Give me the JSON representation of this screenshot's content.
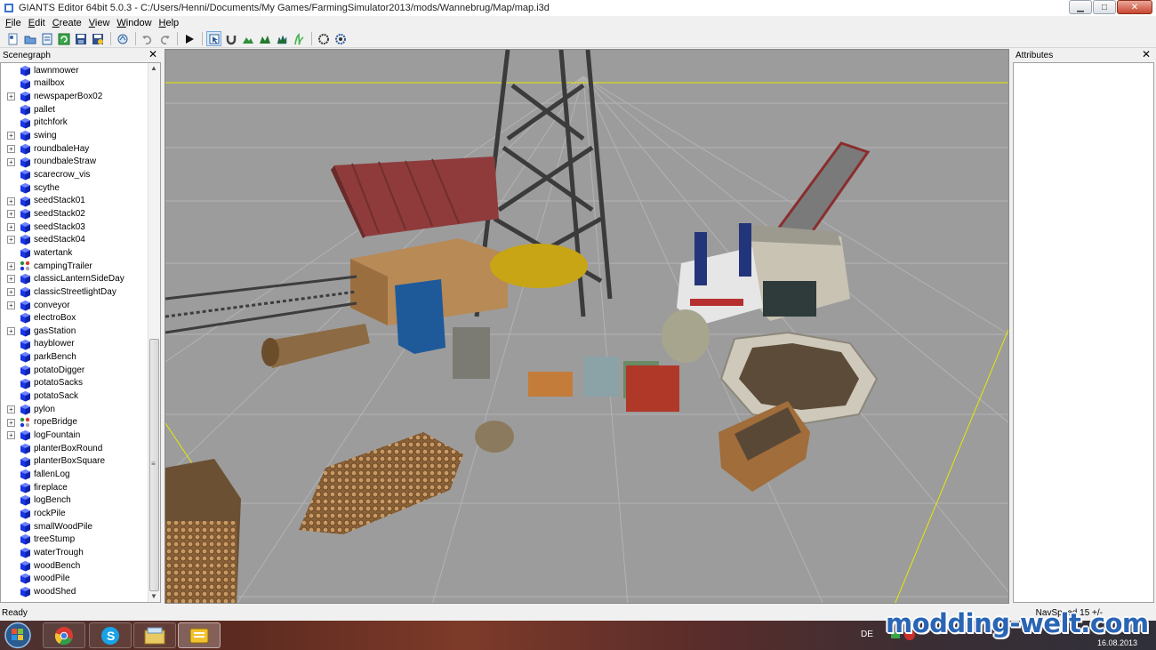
{
  "window": {
    "title": "GIANTS Editor 64bit 5.0.3 - C:/Users/Henni/Documents/My Games/FarmingSimulator2013/mods/Wannebrug/Map/map.i3d",
    "buttons": {
      "minimize": "▁",
      "maximize": "□",
      "close": "✕"
    }
  },
  "menu": {
    "items": [
      {
        "label": "File",
        "u": "F",
        "rest": "ile"
      },
      {
        "label": "Edit",
        "u": "E",
        "rest": "dit"
      },
      {
        "label": "Create",
        "u": "C",
        "rest": "reate"
      },
      {
        "label": "View",
        "u": "V",
        "rest": "iew"
      },
      {
        "label": "Window",
        "u": "W",
        "rest": "indow"
      },
      {
        "label": "Help",
        "u": "H",
        "rest": "elp"
      }
    ]
  },
  "toolbar": {
    "icons": [
      "new-icon",
      "open-icon",
      "import-icon",
      "reload-icon",
      "save-icon",
      "save-as-icon",
      "hand-icon",
      "undo-icon",
      "redo-icon",
      "play-icon",
      "select-tool-icon",
      "magnet-icon",
      "terrain-sculpt-icon",
      "terrain-paint-icon",
      "foliage-paint-icon",
      "grass-paint-icon",
      "nav-icon-a",
      "nav-icon-b"
    ]
  },
  "scenegraph": {
    "title": "Scenegraph",
    "close": "✕",
    "scroll_up": "▲",
    "scroll_down": "▼",
    "scroll_mid": "≡",
    "items": [
      {
        "label": "lawnmower",
        "expandable": false
      },
      {
        "label": "mailbox",
        "expandable": false
      },
      {
        "label": "newspaperBox02",
        "expandable": true
      },
      {
        "label": "pallet",
        "expandable": false
      },
      {
        "label": "pitchfork",
        "expandable": false
      },
      {
        "label": "swing",
        "expandable": true
      },
      {
        "label": "roundbaleHay",
        "expandable": true
      },
      {
        "label": "roundbaleStraw",
        "expandable": true
      },
      {
        "label": "scarecrow_vis",
        "expandable": false
      },
      {
        "label": "scythe",
        "expandable": false
      },
      {
        "label": "seedStack01",
        "expandable": true
      },
      {
        "label": "seedStack02",
        "expandable": true
      },
      {
        "label": "seedStack03",
        "expandable": true
      },
      {
        "label": "seedStack04",
        "expandable": true
      },
      {
        "label": "watertank",
        "expandable": false
      },
      {
        "label": "campingTrailer",
        "expandable": true,
        "transform": true
      },
      {
        "label": "classicLanternSideDay",
        "expandable": true
      },
      {
        "label": "classicStreetlightDay",
        "expandable": true
      },
      {
        "label": "conveyor",
        "expandable": true
      },
      {
        "label": "electroBox",
        "expandable": false
      },
      {
        "label": "gasStation",
        "expandable": true
      },
      {
        "label": "hayblower",
        "expandable": false
      },
      {
        "label": "parkBench",
        "expandable": false
      },
      {
        "label": "potatoDigger",
        "expandable": false
      },
      {
        "label": "potatoSacks",
        "expandable": false
      },
      {
        "label": "potatoSack",
        "expandable": false
      },
      {
        "label": "pylon",
        "expandable": true
      },
      {
        "label": "ropeBridge",
        "expandable": true,
        "transform": true
      },
      {
        "label": "logFountain",
        "expandable": true
      },
      {
        "label": "planterBoxRound",
        "expandable": false
      },
      {
        "label": "planterBoxSquare",
        "expandable": false
      },
      {
        "label": "fallenLog",
        "expandable": false
      },
      {
        "label": "fireplace",
        "expandable": false
      },
      {
        "label": "logBench",
        "expandable": false
      },
      {
        "label": "rockPile",
        "expandable": false
      },
      {
        "label": "smallWoodPile",
        "expandable": false
      },
      {
        "label": "treeStump",
        "expandable": false
      },
      {
        "label": "waterTrough",
        "expandable": false
      },
      {
        "label": "woodBench",
        "expandable": false
      },
      {
        "label": "woodPile",
        "expandable": false
      },
      {
        "label": "woodShed",
        "expandable": false
      }
    ]
  },
  "attributes": {
    "title": "Attributes",
    "close": "✕"
  },
  "status": {
    "text": "Ready",
    "nav_speed": "NavSpeed 15 +/-"
  },
  "taskbar": {
    "apps": [
      "chrome-icon",
      "skype-icon",
      "explorer-icon",
      "giants-editor-icon"
    ],
    "language": "DE",
    "date": "16.08.2013",
    "watermark": "modding-welt.com"
  },
  "colors": {
    "cube": "#1a35e6",
    "viewport_bg": "#9c9c9c",
    "grid": "#b8b8b8",
    "axis": "#e6e600"
  }
}
